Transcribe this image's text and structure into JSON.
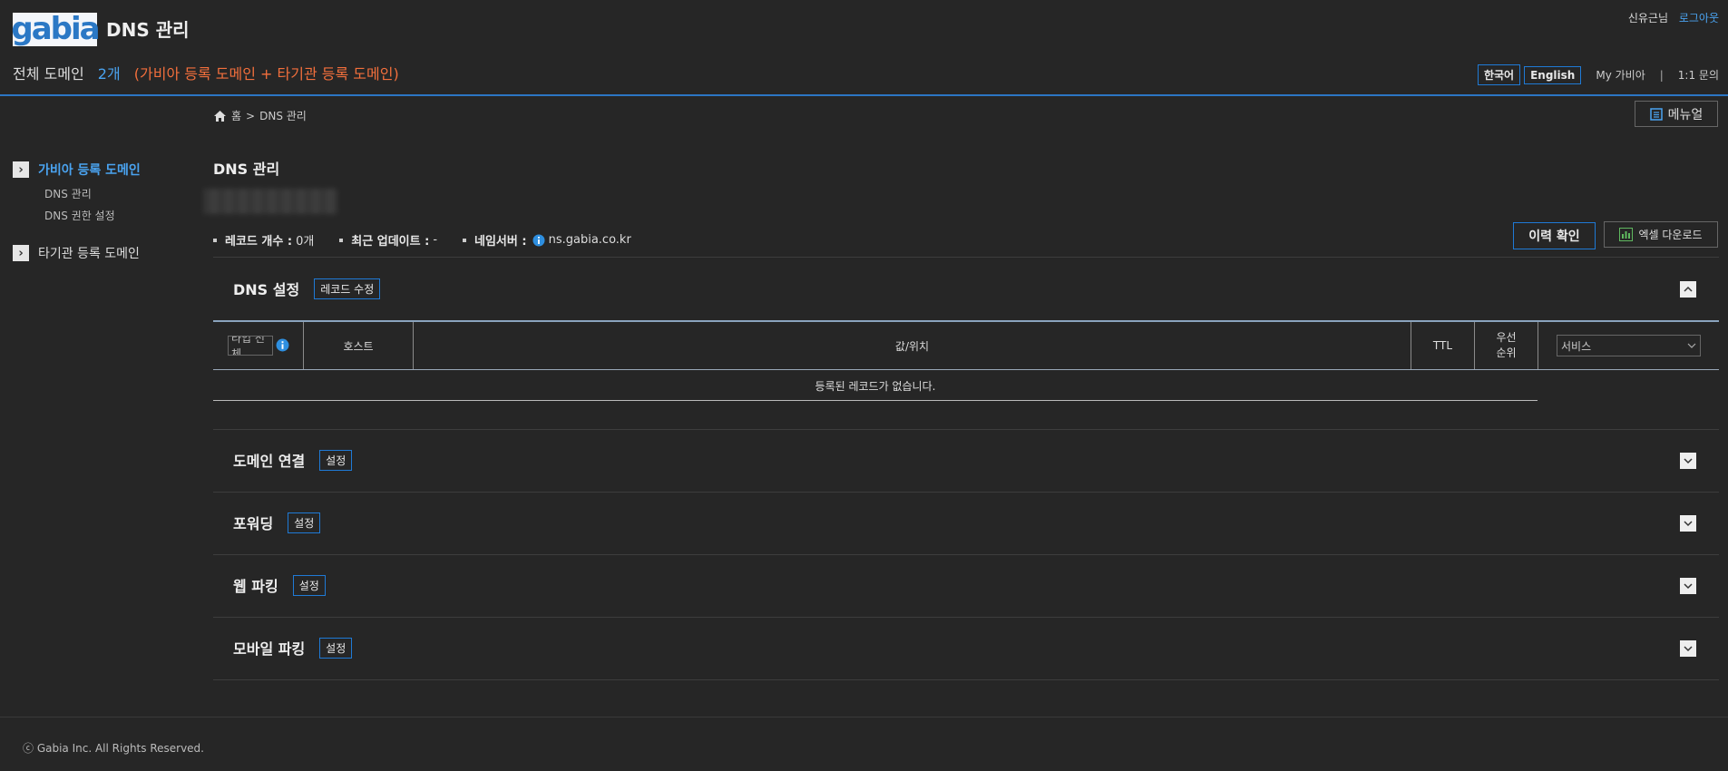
{
  "header": {
    "logo_text": "gabia",
    "title": "DNS 관리",
    "domain_label": "전체 도메인",
    "domain_count": "2개",
    "domain_note": "(가비아 등록 도메인 + 타기관 등록 도메인)",
    "user_name": "신유근님",
    "logout": "로그아웃",
    "lang_korean": "한국어",
    "lang_english": "English",
    "my_gabia": "My 가비아",
    "separator": "|",
    "inquiry": "1:1 문의"
  },
  "breadcrumb": {
    "home": "홈",
    "sep": ">",
    "current": "DNS 관리"
  },
  "manual_button": "메뉴얼",
  "sidebar": {
    "gabia_domains": "가비아 등록 도메인",
    "dns_manage": "DNS 관리",
    "dns_permission": "DNS 권한 설정",
    "other_domains": "타기관 등록 도메인"
  },
  "main": {
    "title": "DNS 관리",
    "stats": {
      "record_label": "레코드 개수 :",
      "record_value": "0개",
      "update_label": "최근 업데이트 :",
      "update_value": "-",
      "ns_label": "네임서버 :",
      "ns_value": "ns.gabia.co.kr"
    },
    "history_button": "이력 확인",
    "excel_button": "엑셀 다운로드"
  },
  "dns_panel": {
    "title": "DNS 설정",
    "edit_button": "레코드 수정",
    "columns": {
      "type": "타입 전체",
      "host": "호스트",
      "value": "값/위치",
      "ttl": "TTL",
      "priority": "우선\n순위",
      "service": "서비스"
    },
    "empty_message": "등록된 레코드가 없습니다."
  },
  "panels": [
    {
      "title": "도메인 연결",
      "button": "설정"
    },
    {
      "title": "포워딩",
      "button": "설정"
    },
    {
      "title": "웹 파킹",
      "button": "설정"
    },
    {
      "title": "모바일 파킹",
      "button": "설정"
    }
  ],
  "footer": {
    "copyright": "ⓒ Gabia Inc. All Rights Reserved."
  },
  "colors": {
    "background": "#262626",
    "accent_blue": "#4aa3f0",
    "border_blue": "#1f7ad6",
    "orange": "#f26f3c"
  }
}
